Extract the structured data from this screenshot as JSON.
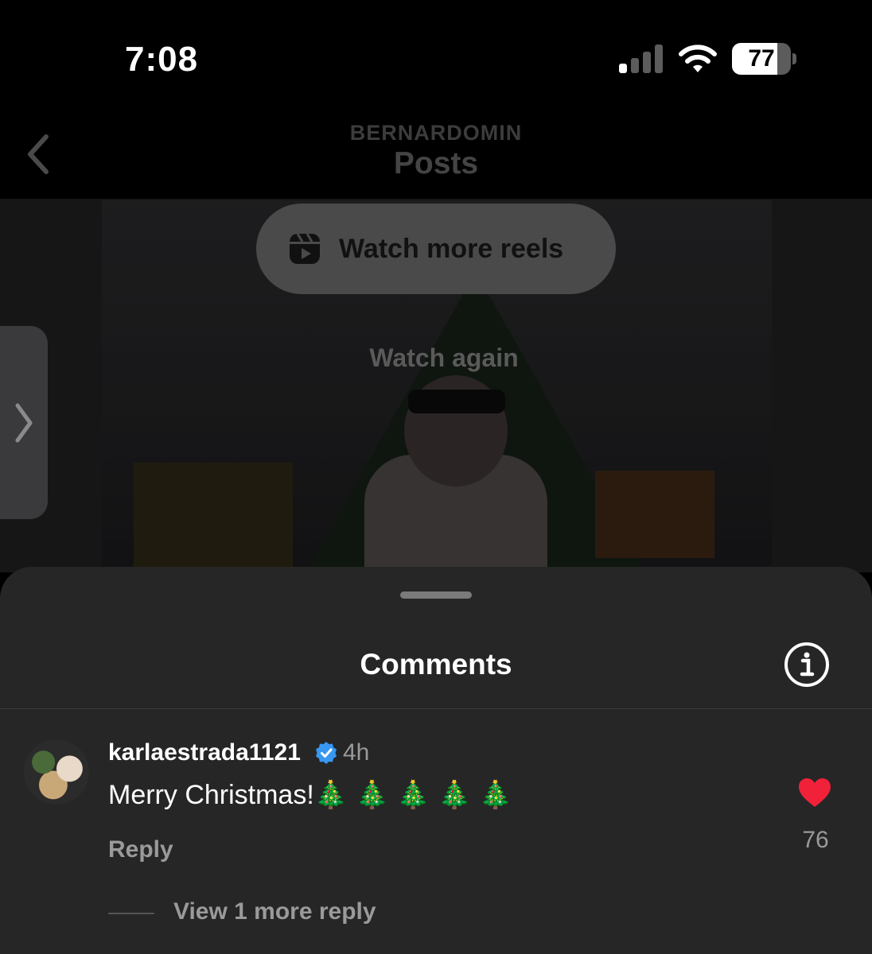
{
  "status_bar": {
    "time": "7:08",
    "battery_level": "77",
    "battery_fraction": 0.77
  },
  "nav": {
    "username": "BERNARDOMIN",
    "title": "Posts"
  },
  "media": {
    "watch_more_label": "Watch more reels",
    "watch_again_label": "Watch again"
  },
  "comments_sheet": {
    "title": "Comments",
    "comment": {
      "username": "karlaestrada1121",
      "time_ago": "4h",
      "text": "Merry Christmas!🎄 🎄 🎄 🎄 🎄",
      "reply_label": "Reply",
      "like_count": "76",
      "view_more_label": "View 1 more reply"
    }
  },
  "colors": {
    "heart": "#f2213a",
    "verified": "#3897f0",
    "sheet_background": "#262626"
  },
  "icons": [
    "signal-icon",
    "wifi-icon",
    "battery-icon",
    "back-chevron-icon",
    "reels-icon",
    "side-chevron-icon",
    "info-icon",
    "verified-badge-icon",
    "heart-icon"
  ]
}
